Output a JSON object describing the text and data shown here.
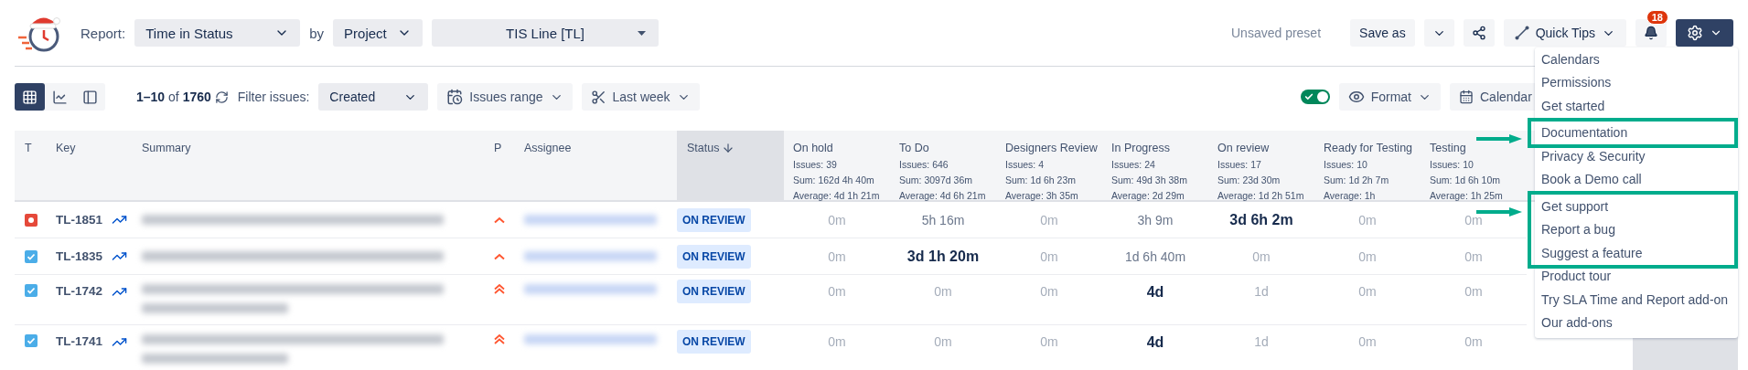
{
  "header": {
    "report_label": "Report:",
    "report_select": "Time in Status",
    "by_label": "by",
    "group_select": "Project",
    "project_select": "TIS Line [TL]",
    "preset": "Unsaved preset",
    "save_as": "Save as",
    "quick_tips": "Quick Tips",
    "notifications": "18"
  },
  "toolbar": {
    "view_modes": [
      {
        "kind": "grid",
        "selected": true
      },
      {
        "kind": "chart",
        "selected": false
      },
      {
        "kind": "panel",
        "selected": false
      }
    ],
    "range": "**1–10** of **1760**",
    "filter_label": "Filter issues:",
    "filter_select": "Created",
    "issues_range": "Issues range",
    "period": "Last week",
    "toggle": {
      "on": true
    },
    "format": "Format",
    "calendar": "Calendar"
  },
  "table": {
    "columns": [
      {
        "label": "T"
      },
      {
        "label": "Key"
      },
      {
        "label": "Summary"
      },
      {
        "label": "P"
      },
      {
        "label": "Assignee"
      },
      {
        "label": "Status",
        "sorted": true
      }
    ],
    "status_columns": [
      {
        "label": "On hold",
        "issues": "Issues: 39",
        "sum": "Sum: 162d 4h 40m",
        "average": "Average: 4d 1h 21m"
      },
      {
        "label": "To Do",
        "issues": "Issues: 646",
        "sum": "Sum: 3097d 36m",
        "average": "Average: 4d 6h 21m"
      },
      {
        "label": "Designers Review",
        "issues": "Issues: 4",
        "sum": "Sum: 1d 6h 23m",
        "average": "Average: 3h 35m"
      },
      {
        "label": "In Progress",
        "issues": "Issues: 24",
        "sum": "Sum: 49d 3h 38m",
        "average": "Average: 2d 29m"
      },
      {
        "label": "On review",
        "issues": "Issues: 17",
        "sum": "Sum: 23d 30m",
        "average": "Average: 1d 2h 51m"
      },
      {
        "label": "Ready for Testing",
        "issues": "Issues: 10",
        "sum": "Sum: 1d 2h 7m",
        "average": "Average: 1h"
      },
      {
        "label": "Testing",
        "issues": "Issues: 10",
        "sum": "Sum: 1d 6h 10m",
        "average": "Average: 1h 25m"
      }
    ],
    "rows": [
      {
        "kind": "bug",
        "key": "TL-1851",
        "summary": {
          "kind": "redacted",
          "wrapped": false
        },
        "priority": {
          "kind": "medium"
        },
        "status": "ON REVIEW",
        "times": [
          {
            "text": "0m",
            "kind": "muted"
          },
          {
            "text": "5h 16m",
            "kind": "normal"
          },
          {
            "text": "0m",
            "kind": "muted"
          },
          {
            "text": "3h 9m",
            "kind": "normal"
          },
          {
            "text": "3d 6h 2m",
            "kind": "strong"
          },
          {
            "text": "0m",
            "kind": "muted"
          },
          {
            "text": "0m",
            "kind": "muted"
          }
        ]
      },
      {
        "kind": "task",
        "key": "TL-1835",
        "summary": {
          "kind": "redacted",
          "wrapped": false
        },
        "priority": {
          "kind": "medium"
        },
        "status": "ON REVIEW",
        "times": [
          {
            "text": "0m",
            "kind": "muted"
          },
          {
            "text": "3d 1h 20m",
            "kind": "strong"
          },
          {
            "text": "0m",
            "kind": "muted"
          },
          {
            "text": "1d 6h 40m",
            "kind": "normal"
          },
          {
            "text": "0m",
            "kind": "muted"
          },
          {
            "text": "0m",
            "kind": "muted"
          },
          {
            "text": "0m",
            "kind": "muted"
          }
        ]
      },
      {
        "kind": "task",
        "key": "TL-1742",
        "summary": {
          "kind": "redacted",
          "wrapped": true
        },
        "priority": {
          "kind": "high"
        },
        "status": "ON REVIEW",
        "times": [
          {
            "text": "0m",
            "kind": "muted"
          },
          {
            "text": "0m",
            "kind": "muted"
          },
          {
            "text": "0m",
            "kind": "muted"
          },
          {
            "text": "4d",
            "kind": "strong"
          },
          {
            "text": "1d",
            "kind": "muted"
          },
          {
            "text": "0m",
            "kind": "muted"
          },
          {
            "text": "0m",
            "kind": "muted"
          }
        ]
      },
      {
        "kind": "task",
        "key": "TL-1741",
        "summary": {
          "kind": "redacted",
          "wrapped": true
        },
        "priority": {
          "kind": "high"
        },
        "status": "ON REVIEW",
        "times": [
          {
            "text": "0m",
            "kind": "muted"
          },
          {
            "text": "0m",
            "kind": "muted"
          },
          {
            "text": "0m",
            "kind": "muted"
          },
          {
            "text": "4d",
            "kind": "strong"
          },
          {
            "text": "1d",
            "kind": "muted"
          },
          {
            "text": "0m",
            "kind": "muted"
          },
          {
            "text": "0m",
            "kind": "muted"
          }
        ]
      }
    ]
  },
  "menu": {
    "sections": [
      {
        "annotated": false,
        "items": [
          "Calendars",
          "Permissions",
          "Get started"
        ]
      },
      {
        "annotated": true,
        "items": [
          "Documentation"
        ]
      },
      {
        "annotated": false,
        "items": [
          "Privacy & Security",
          "Book a Demo call"
        ]
      },
      {
        "annotated": true,
        "items": [
          "Get support",
          "Report a bug",
          "Suggest a feature"
        ]
      },
      {
        "annotated": false,
        "items": [
          "Product tour",
          "Try SLA Time and Report add-on",
          "Our add-ons"
        ]
      }
    ]
  }
}
